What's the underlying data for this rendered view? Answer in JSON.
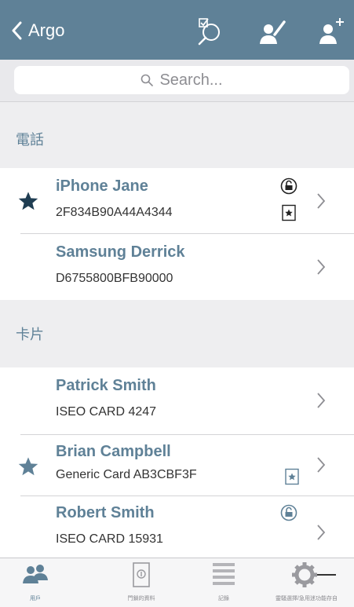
{
  "header": {
    "back_label": "Argo",
    "icons": [
      "search-filter-icon",
      "edit-user-icon",
      "add-user-icon"
    ],
    "bg_color": "#5f8197"
  },
  "search": {
    "placeholder": "Search..."
  },
  "sections": [
    {
      "title": "電話",
      "rows": [
        {
          "name": "iPhone Jane",
          "id": "2F834B90A44A4344",
          "starred": true,
          "badges": [
            "lock-icon",
            "star-card-icon"
          ]
        },
        {
          "name": "Samsung Derrick",
          "id": "D6755800BFB90000",
          "starred": false,
          "badges": []
        }
      ]
    },
    {
      "title": "卡片",
      "rows": [
        {
          "name": "Patrick Smith",
          "id": "ISEO CARD 4247",
          "starred": false,
          "badges": []
        },
        {
          "name": "Brian Campbell",
          "id": "Generic Card AB3CBF3F",
          "starred": true,
          "badges": [
            "star-card-icon"
          ]
        },
        {
          "name": "Robert Smith",
          "id": "ISEO CARD 15931",
          "starred": false,
          "badges": [
            "lock-icon"
          ]
        }
      ]
    }
  ],
  "tabbar": {
    "tabs": [
      {
        "label": "用戶",
        "icon": "users-icon",
        "active": true
      },
      {
        "label": "門鎖的資料",
        "icon": "door-icon",
        "active": false
      },
      {
        "label": "記錄",
        "icon": "list-icon",
        "active": false
      },
      {
        "label": "靈騷選擇/急用迷功能存自",
        "icon": "gear-icon",
        "active": false
      }
    ]
  },
  "colors": {
    "accent": "#5f8197",
    "star": "#5f8197",
    "chevron": "#8e8e93"
  }
}
